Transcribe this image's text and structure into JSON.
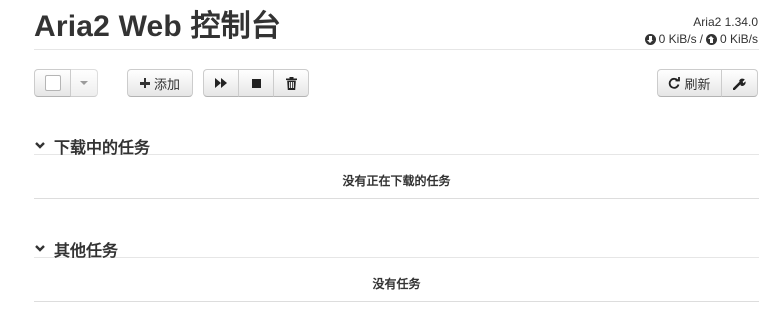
{
  "header": {
    "title": "Aria2 Web 控制台",
    "version": "Aria2 1.34.0",
    "download_speed": "0 KiB/s",
    "speed_separator": "/",
    "upload_speed": "0 KiB/s"
  },
  "toolbar": {
    "add_label": "添加",
    "refresh_label": "刷新"
  },
  "sections": {
    "downloading": {
      "title": "下载中的任务",
      "empty_text": "没有正在下载的任务"
    },
    "other": {
      "title": "其他任务",
      "empty_text": "没有任务"
    }
  },
  "icons": [
    "download-circle-icon",
    "upload-circle-icon",
    "caret-down-icon",
    "plus-icon",
    "resume-icon",
    "stop-icon",
    "trash-icon",
    "refresh-icon",
    "wrench-icon",
    "chevron-down-icon"
  ]
}
